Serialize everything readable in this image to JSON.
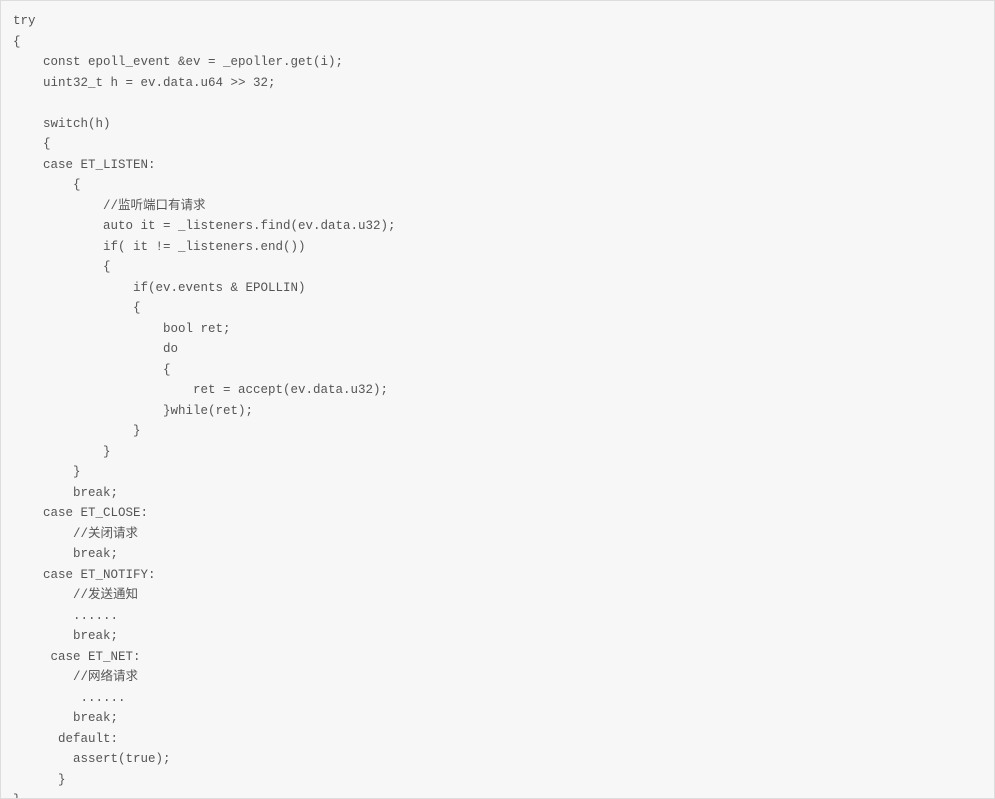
{
  "code": {
    "l01": "try",
    "l02": "{",
    "l03": "    const epoll_event &ev = _epoller.get(i);",
    "l04": "    uint32_t h = ev.data.u64 >> 32;",
    "l05": "",
    "l06": "    switch(h)",
    "l07": "    {",
    "l08": "    case ET_LISTEN:",
    "l09": "        {",
    "l10": "            //监听端口有请求",
    "l11": "            auto it = _listeners.find(ev.data.u32);",
    "l12": "            if( it != _listeners.end())",
    "l13": "            {",
    "l14": "                if(ev.events & EPOLLIN)",
    "l15": "                {",
    "l16": "                    bool ret;",
    "l17": "                    do",
    "l18": "                    {",
    "l19": "                        ret = accept(ev.data.u32);",
    "l20": "                    }while(ret);",
    "l21": "                }",
    "l22": "            }",
    "l23": "        }",
    "l24": "        break;",
    "l25": "    case ET_CLOSE:",
    "l26": "        //关闭请求",
    "l27": "        break;",
    "l28": "    case ET_NOTIFY:",
    "l29": "        //发送通知",
    "l30": "        ......",
    "l31": "        break;",
    "l32": "     case ET_NET:",
    "l33": "        //网络请求",
    "l34": "         ......",
    "l35": "        break;",
    "l36": "      default:",
    "l37": "        assert(true);",
    "l38": "      }",
    "l39": "}"
  }
}
